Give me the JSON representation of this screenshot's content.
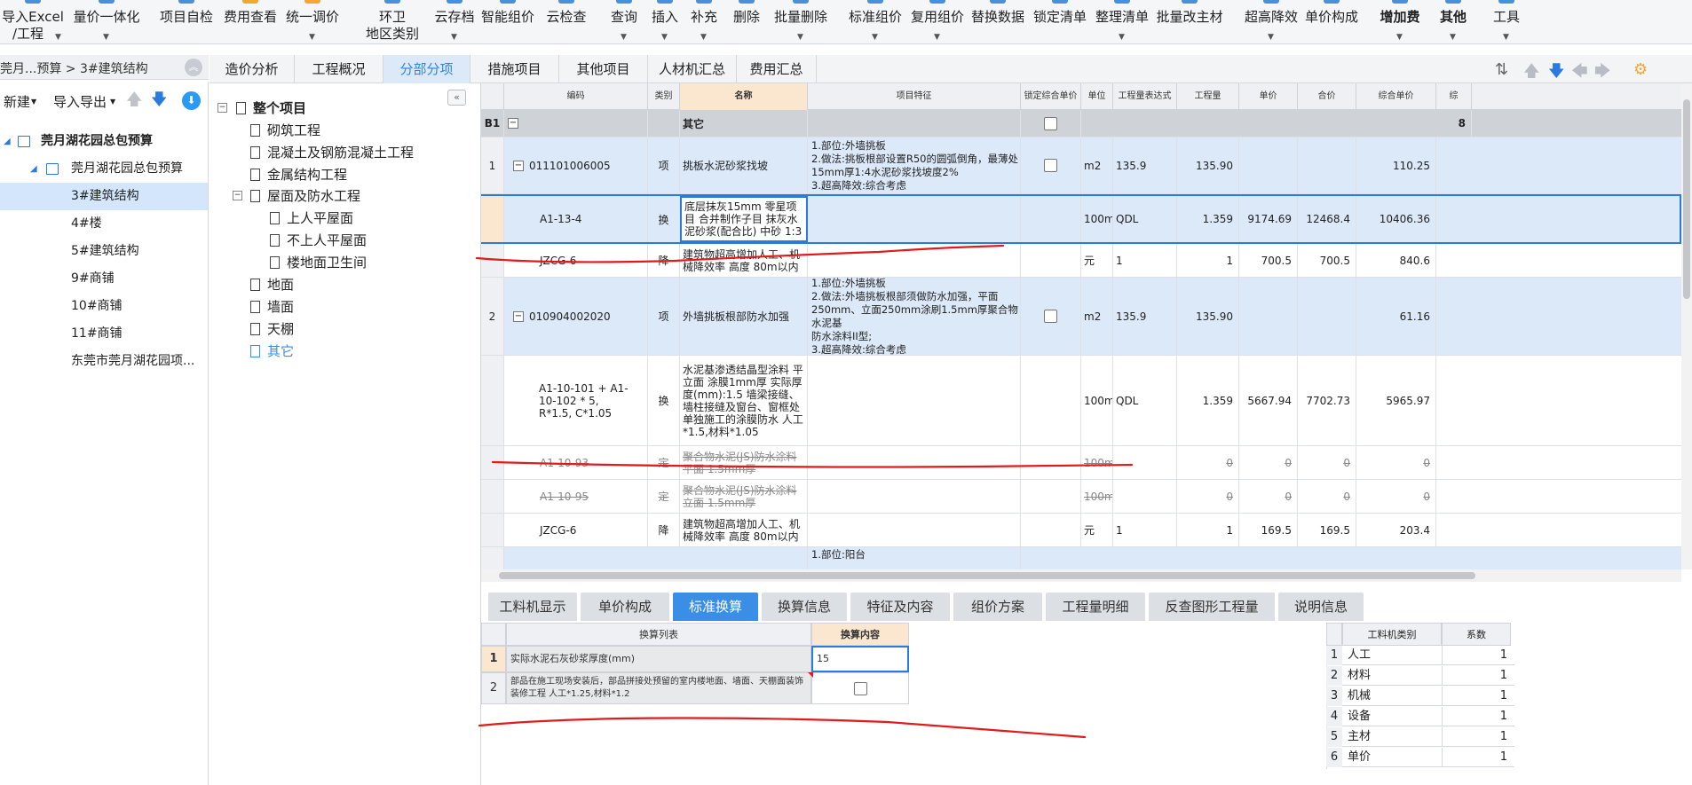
{
  "toolbar": {
    "import_excel": "导入Excel",
    "import_excel_2": "/工程",
    "price_integration": "量价一体化",
    "project_check": "项目自检",
    "fee_view": "费用查看",
    "unified_price": "统一调价",
    "env": "环卫",
    "env_2": "地区类别",
    "cloud_save": "云存档",
    "smart_price": "智能组价",
    "cloud_check": "云检查",
    "query": "查询",
    "insert": "插入",
    "supplement": "补充",
    "delete": "删除",
    "batch_delete": "批量删除",
    "std_price": "标准组价",
    "reuse_price": "复用组价",
    "replace_data": "替换数据",
    "lock_list": "锁定清单",
    "sort_list": "整理清单",
    "batch_main_material": "批量改主材",
    "over_height": "超高降效",
    "unit_composition": "单价构成",
    "add_fee": "增加费",
    "other": "其他",
    "tools": "工具"
  },
  "breadcrumb": "莞月...预算 > 3#建筑结构",
  "left_toolbar": {
    "new": "新建",
    "import_export": "导入导出"
  },
  "project_tree": [
    {
      "label": "莞月湖花园总包预算"
    },
    {
      "label": "莞月湖花园总包预算"
    },
    {
      "label": "3#建筑结构"
    },
    {
      "label": "4#楼"
    },
    {
      "label": "5#建筑结构"
    },
    {
      "label": "9#商铺"
    },
    {
      "label": "10#商铺"
    },
    {
      "label": "11#商铺"
    },
    {
      "label": "东莞市莞月湖花园项..."
    }
  ],
  "sub_tabs": [
    "造价分析",
    "工程概况",
    "分部分项",
    "措施项目",
    "其他项目",
    "人材机汇总",
    "费用汇总"
  ],
  "division_tree": [
    {
      "label": "整个项目"
    },
    {
      "label": "砌筑工程"
    },
    {
      "label": "混凝土及钢筋混凝土工程"
    },
    {
      "label": "金属结构工程"
    },
    {
      "label": "屋面及防水工程"
    },
    {
      "label": "上人平屋面"
    },
    {
      "label": "不上人平屋面"
    },
    {
      "label": "楼地面卫生间"
    },
    {
      "label": "地面"
    },
    {
      "label": "墙面"
    },
    {
      "label": "天棚"
    },
    {
      "label": "其它"
    }
  ],
  "grid": {
    "headers": [
      "编码",
      "类别",
      "名称",
      "项目特征",
      "锁定综合单价",
      "单位",
      "工程量表达式",
      "工程量",
      "单价",
      "合价",
      "综合单价",
      "综"
    ],
    "section": {
      "index": "B1",
      "name": "其它",
      "tail": "8"
    },
    "rows": [
      {
        "idx": "1",
        "code": "011101006005",
        "type": "项",
        "name": "挑板水泥砂浆找坡",
        "feature": [
          "1.部位:外墙挑板",
          "2.做法:挑板根部设置R50的圆弧倒角，最薄处",
          "15mm厚1:4水泥砂浆找坡度2%",
          "3.超高降效:综合考虑"
        ],
        "unit": "m2",
        "expr": "135.9",
        "qty": "135.90",
        "price": "",
        "total": "",
        "comp": "110.25"
      },
      {
        "idx": "",
        "code": "A1-13-4",
        "type": "换",
        "name": "底层抹灰15mm 零星项目 合并制作子目 抹灰水泥砂浆(配合比) 中砂 1:3",
        "feature": [],
        "unit": "100m2",
        "expr": "QDL",
        "qty": "1.359",
        "price": "9174.69",
        "total": "12468.4",
        "comp": "10406.36"
      },
      {
        "idx": "",
        "code": "JZCG-6",
        "type": "降",
        "name": "建筑物超高增加人工、机械降效率 高度 80m以内",
        "feature": [],
        "unit": "元",
        "expr": "1",
        "qty": "1",
        "price": "700.5",
        "total": "700.5",
        "comp": "840.6"
      },
      {
        "idx": "2",
        "code": "010904002020",
        "type": "项",
        "name": "外墙挑板根部防水加强",
        "feature": [
          "1.部位:外墙挑板",
          "2.做法:外墙挑板根部须做防水加强，平面",
          "250mm、立面250mm涂刷1.5mm厚聚合物水泥基",
          "防水涂料II型;",
          "3.超高降效:综合考虑"
        ],
        "unit": "m2",
        "expr": "135.9",
        "qty": "135.90",
        "price": "",
        "total": "",
        "comp": "61.16"
      },
      {
        "idx": "",
        "code": "A1-10-101 + A1-10-102 * 5, R*1.5, C*1.05",
        "type": "换",
        "name": "水泥基渗透结晶型涂料 平立面 涂膜1mm厚 实际厚度(mm):1.5 墙梁接缝、墙柱接缝及窗台、窗框处单独施工的涂膜防水 人工*1.5,材料*1.05",
        "feature": [],
        "unit": "100m2",
        "expr": "QDL",
        "qty": "1.359",
        "price": "5667.94",
        "total": "7702.73",
        "comp": "5965.97"
      },
      {
        "idx": "",
        "code": "A1-10-93",
        "type": "定",
        "name": "聚合物水泥(JS)防水涂料 平面 1.5mm厚",
        "feature": [],
        "unit": "100m2",
        "expr": "",
        "qty": "0",
        "price": "0",
        "total": "0",
        "comp": "0"
      },
      {
        "idx": "",
        "code": "A1-10-95",
        "type": "定",
        "name": "聚合物水泥(JS)防水涂料 立面 1.5mm厚",
        "feature": [],
        "unit": "100m2",
        "expr": "",
        "qty": "0",
        "price": "0",
        "total": "0",
        "comp": "0"
      },
      {
        "idx": "",
        "code": "JZCG-6",
        "type": "降",
        "name": "建筑物超高增加人工、机械降效率 高度 80m以内",
        "feature": [],
        "unit": "元",
        "expr": "1",
        "qty": "1",
        "price": "169.5",
        "total": "169.5",
        "comp": "203.4"
      },
      {
        "idx": "",
        "code": "",
        "type": "",
        "name": "",
        "feature": [
          "1.部位:阳台"
        ],
        "unit": "",
        "expr": "",
        "qty": "",
        "price": "",
        "total": "",
        "comp": ""
      }
    ]
  },
  "bottom_tabs": [
    "工料机显示",
    "单价构成",
    "标准换算",
    "换算信息",
    "特征及内容",
    "组价方案",
    "工程量明细",
    "反查图形工程量",
    "说明信息"
  ],
  "conversion": {
    "headers": [
      "换算列表",
      "换算内容"
    ],
    "rows": [
      {
        "idx": "1",
        "text": "实际水泥石灰砂浆厚度(mm)",
        "value": "15"
      },
      {
        "idx": "2",
        "text": "部品在施工现场安装后，部品拼接处预留的室内楼地面、墙面、天棚面装饰装修工程 人工*1.25,材料*1.2",
        "value": ""
      }
    ]
  },
  "coefficients": {
    "headers": [
      "工料机类别",
      "系数"
    ],
    "rows": [
      {
        "idx": "1",
        "name": "人工",
        "value": "1"
      },
      {
        "idx": "2",
        "name": "材料",
        "value": "1"
      },
      {
        "idx": "3",
        "name": "机械",
        "value": "1"
      },
      {
        "idx": "4",
        "name": "设备",
        "value": "1"
      },
      {
        "idx": "5",
        "name": "主材",
        "value": "1"
      },
      {
        "idx": "6",
        "name": "单价",
        "value": "1"
      }
    ]
  },
  "colors": {
    "accent": "#3a8ee6",
    "selected_row": "#dce9f9",
    "name_header": "#fbe7cf",
    "annotation": "#e21a1a"
  }
}
